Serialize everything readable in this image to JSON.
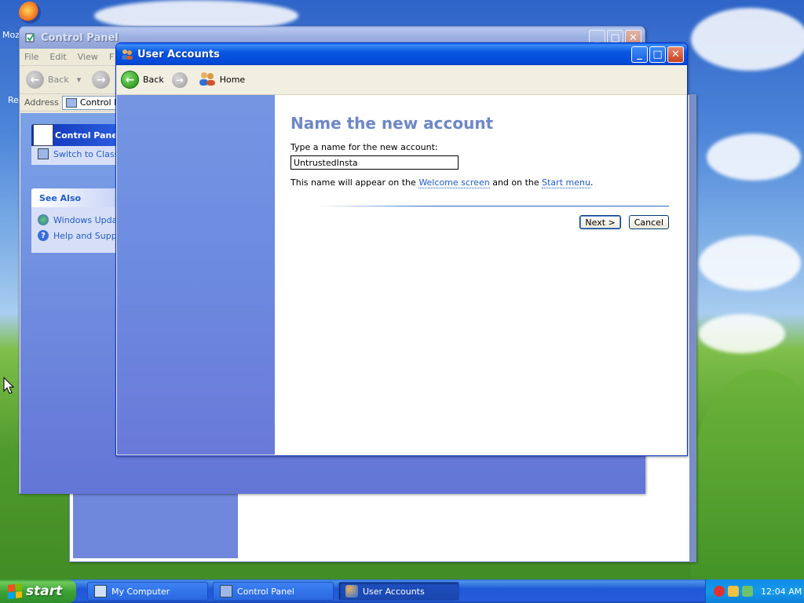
{
  "desktop": {
    "icon_firefox_label": "Moz",
    "icon_recycle_label": "Re"
  },
  "control_panel_window": {
    "title": "Control Panel",
    "menu": [
      "File",
      "Edit",
      "View",
      "F"
    ],
    "back_label": "Back",
    "address_label": "Address",
    "address_value": "Control Pa",
    "panel_title": "Control Panel",
    "switch_view": "Switch to Class",
    "see_also_title": "See Also",
    "see_also_items": [
      "Windows Updat",
      "Help and Suppo"
    ]
  },
  "user_accounts_window": {
    "title": "User Accounts",
    "toolbar": {
      "back_label": "Back",
      "home_label": "Home"
    },
    "heading": "Name the new account",
    "prompt": "Type a name for the new account:",
    "name_value": "UntrustedInsta",
    "note_prefix": "This name will appear on the ",
    "note_link1": "Welcome screen",
    "note_middle": " and on the ",
    "note_link2": "Start menu",
    "note_suffix": ".",
    "next_label": "Next >",
    "cancel_label": "Cancel"
  },
  "taskbar": {
    "start_label": "start",
    "items": [
      {
        "label": "My Computer",
        "active": false
      },
      {
        "label": "Control Panel",
        "active": false
      },
      {
        "label": "User Accounts",
        "active": true
      }
    ],
    "clock": "12:04 AM"
  },
  "colors": {
    "title_active": "#0857e3",
    "heading": "#6e87c6",
    "link": "#215dc6",
    "start_green": "#3da336"
  }
}
